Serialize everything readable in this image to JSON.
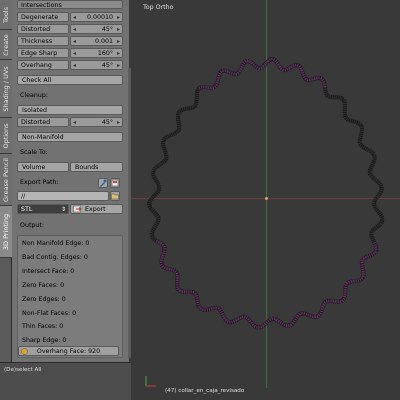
{
  "tabs": [
    "Tools",
    "Create",
    "Shading / UVs",
    "Options",
    "Grease Pencil",
    "3D Printing"
  ],
  "panel": {
    "section": "Intersections",
    "checks": [
      {
        "label": "Degenerate",
        "value": "0.00010"
      },
      {
        "label": "Distorted",
        "value": "45°"
      },
      {
        "label": "Thickness",
        "value": "0.001"
      },
      {
        "label": "Edge Sharp",
        "value": "160°"
      },
      {
        "label": "Overhang",
        "value": "45°"
      }
    ],
    "check_all": "Check All",
    "cleanup_label": "Cleanup:",
    "isolated": "Isolated",
    "distorted": {
      "label": "Distorted",
      "value": "45°"
    },
    "non_manifold": "Non-Manifold",
    "scale_to_label": "Scale To:",
    "volume": "Volume",
    "bounds": "Bounds",
    "export_path_label": "Export Path:",
    "export_path_value": "//",
    "format": "STL",
    "export": "Export",
    "output_label": "Output:",
    "output": [
      "Non Manifold Edge: 0",
      "Bad Contig. Edges: 0",
      "Intersect Face: 0",
      "Zero Faces: 0",
      "Zero Edges: 0",
      "Non-Flat Faces: 0",
      "Thin Faces: 0",
      "Sharp Edge: 0"
    ],
    "overhang_face": "Overhang Face: 920"
  },
  "operator": "(De)select All",
  "viewport": {
    "title": "Top Ortho",
    "object_info": "(47) collar_en_caja_revisado"
  },
  "colors": {
    "mesh_dark": "#1c1c1c",
    "mesh_select": "#8b2a8b",
    "x_axis": "#6e3b3b",
    "y_axis": "#3f6e3f"
  }
}
